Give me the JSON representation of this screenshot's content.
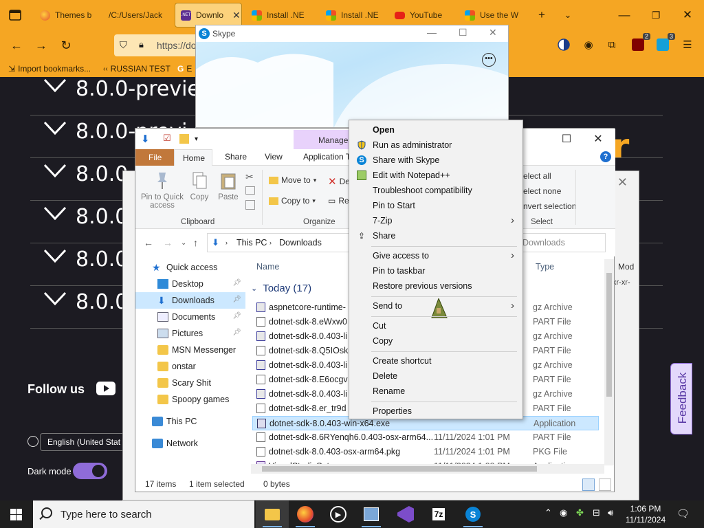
{
  "browser": {
    "tabs": [
      {
        "label": "Themes b",
        "icon": "firefox-icon"
      },
      {
        "label": "/C:/Users/Jack",
        "icon": ""
      },
      {
        "label": "Downlo",
        "icon": "dotnet-icon",
        "active": true
      },
      {
        "label": "Install .NE",
        "icon": "ms-icon"
      },
      {
        "label": "Install .NE",
        "icon": "ms-icon"
      },
      {
        "label": "YouTube",
        "icon": "youtube-icon"
      },
      {
        "label": "Use the W",
        "icon": "ms-icon"
      }
    ],
    "url": "https://do",
    "bookmarks": [
      "Import bookmarks...",
      "RUSSIAN TEST",
      "E"
    ],
    "extension_badges": [
      "2",
      "3"
    ]
  },
  "webpage": {
    "releases": [
      "8.0.0-previe",
      "8.0.0-previ",
      "8.0.0",
      "8.0.0",
      "8.0.0",
      "8.0.0"
    ],
    "brand": "eGear",
    "follow_us": "Follow us",
    "language": "English (United Stat",
    "dark_mode_label": "Dark mode",
    "feedback": "Feedback"
  },
  "skype": {
    "title": "Skype",
    "more_label": "•••"
  },
  "explorer": {
    "manage_tab": "Manage",
    "ribbon_tabs": {
      "file": "File",
      "home": "Home",
      "share": "Share",
      "view": "View",
      "app_tools": "Application T"
    },
    "ribbon": {
      "pin": "Pin to Quick access",
      "copy": "Copy",
      "paste": "Paste",
      "clipboard_group": "Clipboard",
      "move_to": "Move to",
      "copy_to": "Copy to",
      "delete": "De",
      "rename": "Re",
      "organize_group": "Organize",
      "select_all": "elect all",
      "select_none": "elect none",
      "invert_selection": "nvert selection",
      "select_group": "Select"
    },
    "address": {
      "this_pc": "This PC",
      "downloads": "Downloads",
      "search_placeholder": "Downloads"
    },
    "nav": [
      {
        "label": "Quick access",
        "type": "star"
      },
      {
        "label": "Desktop",
        "type": "desktop",
        "pinned": true
      },
      {
        "label": "Downloads",
        "type": "download",
        "pinned": true,
        "selected": true
      },
      {
        "label": "Documents",
        "type": "doc",
        "pinned": true
      },
      {
        "label": "Pictures",
        "type": "pic",
        "pinned": true
      },
      {
        "label": "MSN Messenger",
        "type": "folder"
      },
      {
        "label": "onstar",
        "type": "folder"
      },
      {
        "label": "Scary Shit",
        "type": "folder"
      },
      {
        "label": "Spoopy games",
        "type": "folder"
      },
      {
        "label": "This PC",
        "type": "pc"
      },
      {
        "label": "Network",
        "type": "net"
      }
    ],
    "columns": {
      "name": "Name",
      "type": "Type"
    },
    "group": "Today (17)",
    "files": [
      {
        "name": "aspnetcore-runtime-",
        "date": "",
        "type": "gz Archive",
        "icon": "gz"
      },
      {
        "name": "dotnet-sdk-8.eWxw0",
        "date": "",
        "type": "PART File",
        "icon": "file"
      },
      {
        "name": "dotnet-sdk-8.0.403-li",
        "date": "",
        "type": "gz Archive",
        "icon": "gz"
      },
      {
        "name": "dotnet-sdk-8.Q5IOskl",
        "date": "",
        "type": "PART File",
        "icon": "file"
      },
      {
        "name": "dotnet-sdk-8.0.403-li",
        "date": "",
        "type": "gz Archive",
        "icon": "gz"
      },
      {
        "name": "dotnet-sdk-8.E6ocgv",
        "date": "",
        "type": "PART File",
        "icon": "file"
      },
      {
        "name": "dotnet-sdk-8.0.403-li",
        "date": "",
        "type": "gz Archive",
        "icon": "gz"
      },
      {
        "name": "dotnet-sdk-8.er_tr9d",
        "date": "",
        "type": "PART File",
        "icon": "file"
      },
      {
        "name": "dotnet-sdk-8.0.403-win-x64.exe",
        "date": "",
        "type": "Application",
        "icon": "app",
        "selected": true
      },
      {
        "name": "dotnet-sdk-8.6RYenqh6.0.403-osx-arm64...",
        "date": "11/11/2024 1:01 PM",
        "type": "PART File",
        "icon": "file"
      },
      {
        "name": "dotnet-sdk-8.0.403-osx-arm64.pkg",
        "date": "11/11/2024 1:01 PM",
        "type": "PKG File",
        "icon": "file"
      },
      {
        "name": "VisualStudioSetup.exe",
        "date": "11/11/2024 1:00 PM",
        "type": "Application",
        "icon": "app"
      }
    ],
    "status": {
      "count": "17 items",
      "selected": "1 item selected",
      "size": "0 bytes"
    }
  },
  "sevenzip": {
    "col": "Mod",
    "value": "xr-xr-"
  },
  "context_menu": {
    "items": [
      {
        "label": "Open",
        "bold": true
      },
      {
        "label": "Run as administrator",
        "icon": "shield-icon"
      },
      {
        "label": "Share with Skype",
        "icon": "skype-icon"
      },
      {
        "label": "Edit with Notepad++",
        "icon": "notepad-icon"
      },
      {
        "label": "Troubleshoot compatibility"
      },
      {
        "label": "Pin to Start"
      },
      {
        "label": "7-Zip",
        "submenu": true
      },
      {
        "label": "Share",
        "icon": "share-icon"
      },
      {
        "label": "Give access to",
        "submenu": true
      },
      {
        "label": "Pin to taskbar"
      },
      {
        "label": "Restore previous versions"
      },
      {
        "label": "Send to",
        "submenu": true
      },
      {
        "label": "Cut"
      },
      {
        "label": "Copy"
      },
      {
        "label": "Create shortcut"
      },
      {
        "label": "Delete"
      },
      {
        "label": "Rename"
      },
      {
        "label": "Properties"
      }
    ]
  },
  "taskbar": {
    "search_placeholder": "Type here to search",
    "time": "1:06 PM",
    "date": "11/11/2024",
    "sevenzip_label": "7z"
  }
}
